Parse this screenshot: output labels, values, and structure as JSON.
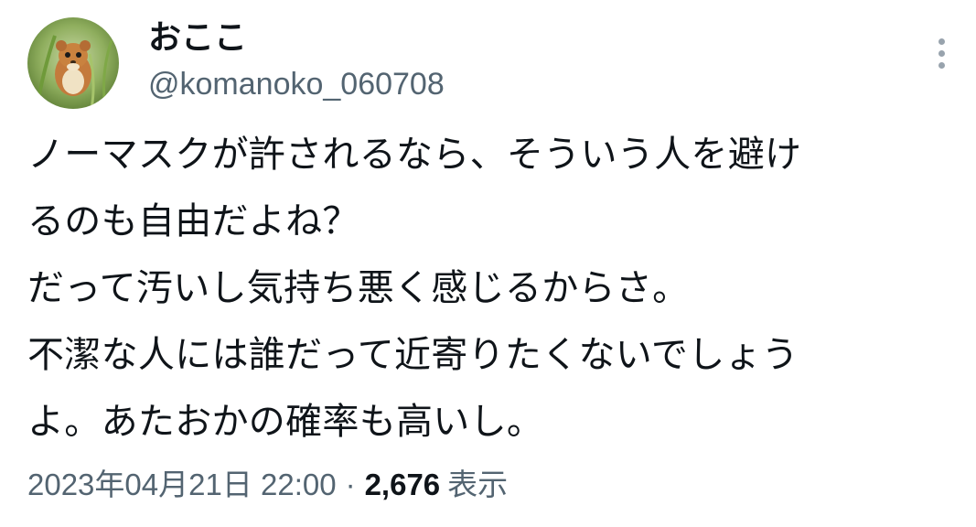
{
  "tweet": {
    "display_name": "おここ",
    "handle": "@komanoko_060708",
    "avatar_icon": "harvest-mouse-avatar-icon",
    "more_icon": "more-vertical-icon",
    "text_lines": [
      "ノーマスクが許されるなら、そういう人を避け",
      "るのも自由だよね？",
      "だって汚いし気持ち悪く感じるからさ。",
      "不潔な人には誰だって近寄りたくないでしょう",
      "よ。あたおかの確率も高いし。"
    ],
    "timestamp": "2023年04月21日 22:00",
    "separator": "·",
    "views_count": "2,676",
    "views_label": "表示"
  },
  "colors": {
    "primary_text": "#0f1419",
    "secondary_text": "#536471",
    "background": "#ffffff"
  }
}
